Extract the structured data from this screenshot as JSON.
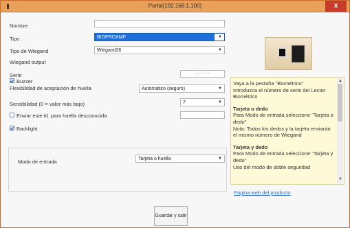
{
  "window": {
    "title": "Portal(192.168.1.100)",
    "close_label": "x"
  },
  "form": {
    "nombre_label": "Nombre",
    "nombre_value": "",
    "tipo_label": "Tipo",
    "tipo_value": "BIOPROXMF",
    "tipo_wiegand_label": "Tipo de Wiegand",
    "tipo_wiegand_value": "Wiegand26",
    "wiegand_output_label": "Wiegand output",
    "serie_label": "Serie",
    "serie_value": "- - - - - -",
    "buzzer_label": "Buzzer",
    "buzzer_checked": true,
    "flexibilidad_label": "Flexibilidad de aceptación de huella",
    "flexibilidad_value": "Automático (seguro)",
    "sensibilidad_label": "Sensibilidad (0 = valor más bajo)",
    "sensibilidad_value": "7",
    "enviar_label": "Enviar este Id. para huella desconocida",
    "enviar_checked": false,
    "enviar_value": "",
    "backlight_label": "Backlight",
    "backlight_checked": true,
    "modo_label": "Modo de entrada",
    "modo_value": "Tarjeta o huella",
    "save_label": "Guardar y salir"
  },
  "help": {
    "intro": "Vaya a la pestaña \"Biométrico\"\nIntroduzca el número de serie del Lector Biométrico",
    "h1": "Tarjeta o dedo",
    "p1": "Para Modo de entrada seleccione \"Tarjeta o dedo\"\nNota: Todos los dedos y la tarjeta enviarán el mismo número de Wiegand",
    "h2": "Tarjeta y dedo",
    "p2": "Para Modo de entrada seleccione \"Tarjeta y dedo\"\nUso del modo de doble seguridad"
  },
  "link_text": "Página web del producto",
  "colors": {
    "title_bar": "#e8a05a",
    "close": "#c73b2a",
    "selection": "#1e70d8",
    "help_bg": "#fef9d6",
    "link": "#2f6fd6"
  },
  "icons": {
    "device": "biometric-reader-image"
  }
}
